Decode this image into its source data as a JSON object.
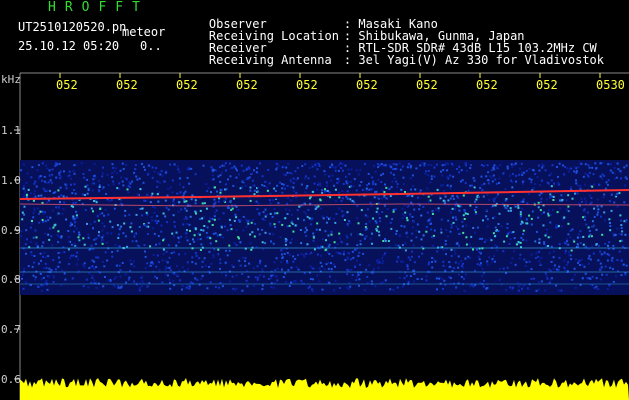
{
  "header": {
    "app_title": "HROFFT",
    "file_name": "UT2510120520.pn",
    "meteor_label": "meteor",
    "date_time": "25.10.12 05:20",
    "count": "0.."
  },
  "info": [
    {
      "key": "Observer",
      "value": ": Masaki Kano"
    },
    {
      "key": "Receiving Location",
      "value": ": Shibukawa, Gunma, Japan"
    },
    {
      "key": "Receiver",
      "value": ": RTL-SDR SDR# 43dB L15 103.2MHz CW"
    },
    {
      "key": "Receiving Antenna",
      "value": ": 3el Yagi(V) Az 330 for Vladivostok"
    }
  ],
  "time_ticks": [
    "052",
    "052",
    "052",
    "052",
    "052",
    "052",
    "052",
    "052",
    "052",
    "0530"
  ],
  "y_axis": {
    "unit": "kHz",
    "labels": [
      "1.1",
      "1.0",
      "0.9",
      "0.8",
      "0.7",
      "0.6"
    ]
  },
  "colors": {
    "background": "#000000",
    "title_green": "#33dd33",
    "tick_yellow": "#ffff33",
    "amplitude_yellow": "#ffff00",
    "noise_blue": "#1030c0",
    "signal_red": "#ff3030"
  }
}
